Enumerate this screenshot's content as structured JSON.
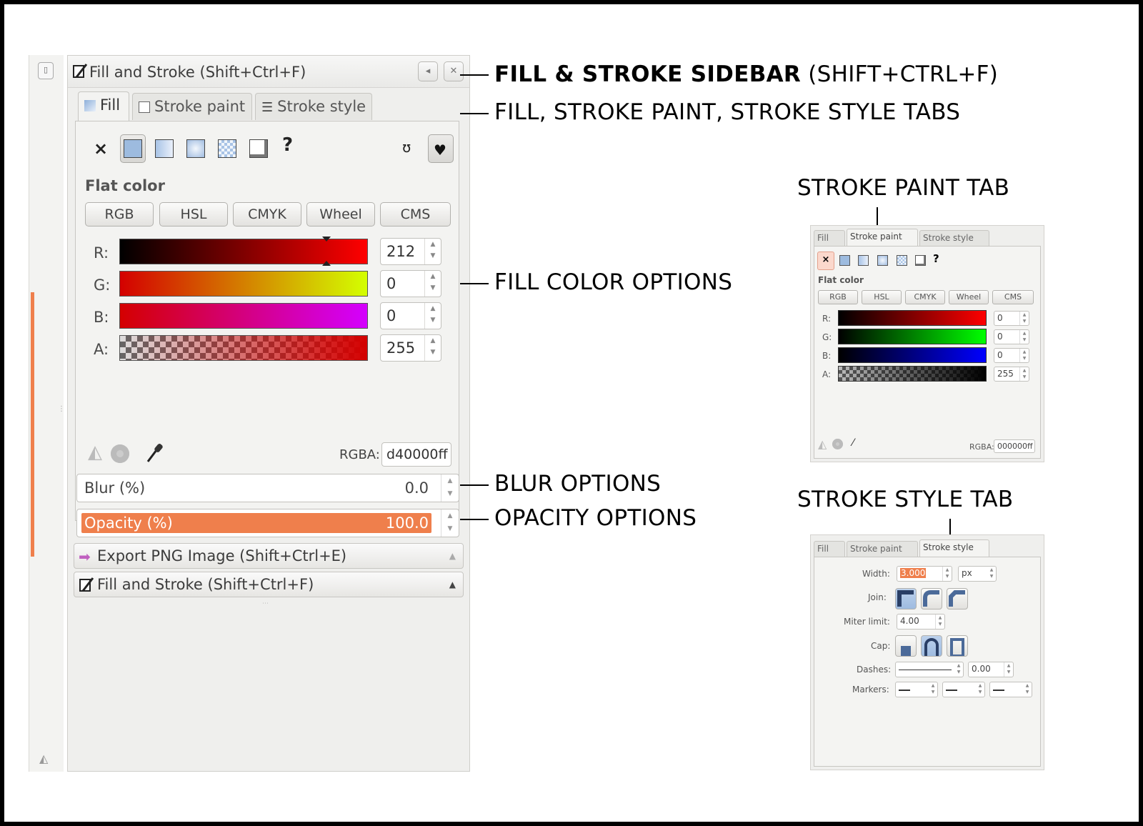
{
  "panel": {
    "title": "Fill and Stroke (Shift+Ctrl+F)",
    "tabs": [
      "Fill",
      "Stroke paint",
      "Stroke style"
    ],
    "section_title": "Flat color",
    "modes": [
      "RGB",
      "HSL",
      "CMYK",
      "Wheel",
      "CMS"
    ],
    "channels": [
      {
        "label": "R:",
        "value": "212",
        "gradient": [
          "#000000",
          "#ff0000"
        ]
      },
      {
        "label": "G:",
        "value": "0",
        "gradient": [
          "#d40000",
          "#d4ff00"
        ]
      },
      {
        "label": "B:",
        "value": "0",
        "gradient": [
          "#d40000",
          "#d400ff"
        ]
      },
      {
        "label": "A:",
        "value": "255",
        "gradient": [
          "#d40000",
          "#d40000"
        ]
      }
    ],
    "rgba_label": "RGBA:",
    "rgba_value": "d40000ff",
    "blur_label": "Blur (%)",
    "blur_value": "0.0",
    "opacity_label": "Opacity (%)",
    "opacity_value": "100.0",
    "collapsed": [
      "Export PNG Image (Shift+Ctrl+E)",
      "Fill and Stroke (Shift+Ctrl+F)"
    ],
    "help_glyph": "?",
    "none_glyph": "×",
    "accent": "#ef7f4c"
  },
  "annotations": {
    "sidebar_bold": "FILL & STROKE SIDEBAR",
    "sidebar_rest": " (SHIFT+CTRL+F)",
    "tabs": "FILL, STROKE PAINT, STROKE STYLE TABS",
    "fill_color": "FILL COLOR OPTIONS",
    "blur": "BLUR OPTIONS",
    "opacity": "OPACITY OPTIONS",
    "stroke_paint_tab": "STROKE PAINT TAB",
    "stroke_style_tab": "STROKE STYLE TAB"
  },
  "stroke_paint": {
    "tabs": [
      "Fill",
      "Stroke paint",
      "Stroke style"
    ],
    "section_title": "Flat color",
    "modes": [
      "RGB",
      "HSL",
      "CMYK",
      "Wheel",
      "CMS"
    ],
    "channels": [
      {
        "label": "R:",
        "value": "0",
        "gradient": [
          "#000000",
          "#ff0000"
        ]
      },
      {
        "label": "G:",
        "value": "0",
        "gradient": [
          "#000000",
          "#00ff00"
        ]
      },
      {
        "label": "B:",
        "value": "0",
        "gradient": [
          "#000000",
          "#0000ff"
        ]
      },
      {
        "label": "A:",
        "value": "255",
        "gradient": [
          "#000000",
          "#000000"
        ]
      }
    ],
    "rgba_label": "RGBA:",
    "rgba_value": "000000ff"
  },
  "stroke_style": {
    "tabs": [
      "Fill",
      "Stroke paint",
      "Stroke style"
    ],
    "width_label": "Width:",
    "width_value": "3.000",
    "width_unit": "px",
    "join_label": "Join:",
    "miter_label": "Miter limit:",
    "miter_value": "4.00",
    "cap_label": "Cap:",
    "dashes_label": "Dashes:",
    "dashes_value": "0.00",
    "markers_label": "Markers:"
  }
}
